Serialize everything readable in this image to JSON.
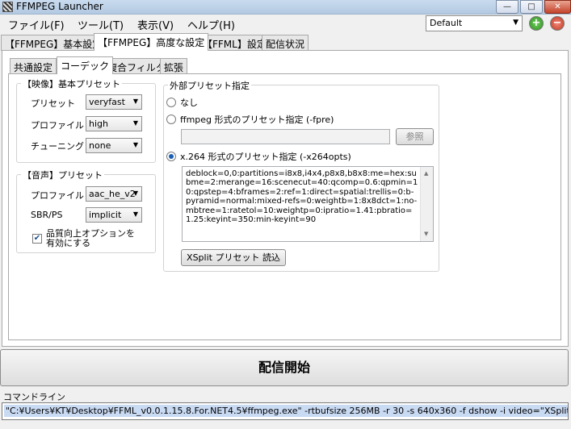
{
  "window": {
    "title": "FFMPEG Launcher"
  },
  "menu": [
    "ファイル(F)",
    "ツール(T)",
    "表示(V)",
    "ヘルプ(H)"
  ],
  "preset": {
    "selected": "Default"
  },
  "main_tabs": [
    "【FFMPEG】基本設定",
    "【FFMPEG】高度な設定",
    "【FFML】設定",
    "配信状況"
  ],
  "sub_tabs": [
    "共通設定",
    "コーデック",
    "複合フィルタ",
    "拡張"
  ],
  "video_group": {
    "title": "【映像】基本プリセット",
    "preset_label": "プリセット",
    "preset_value": "veryfast",
    "profile_label": "プロファイル",
    "profile_value": "high",
    "tuning_label": "チューニング",
    "tuning_value": "none"
  },
  "audio_group": {
    "title": "【音声】プリセット",
    "profile_label": "プロファイル",
    "profile_value": "aac_he_v2",
    "sbr_label": "SBR/PS",
    "sbr_value": "implicit",
    "quality_line1": "品質向上オプションを",
    "quality_line2": "有効にする",
    "quality_checked": true
  },
  "external_group": {
    "title": "外部プリセット指定",
    "opt_none": "なし",
    "opt_fpre": "ffmpeg 形式のプリセット指定 (-fpre)",
    "browse_label": "参照",
    "opt_x264": "x.264 形式のプリセット指定 (-x264opts)",
    "selected": "x264",
    "x264opts": "deblock=0,0:partitions=i8x8,i4x4,p8x8,b8x8:me=hex:subme=2:merange=16:scenecut=40:qcomp=0.6:qpmin=10:qpstep=4:bframes=2:ref=1:direct=spatial:trellis=0:b-pyramid=normal:mixed-refs=0:weightb=1:8x8dct=1:no-mbtree=1:ratetol=10:weightp=0:ipratio=1.41:pbratio=1.25:keyint=350:min-keyint=90",
    "xsplit_button": "XSplit プリセット 読込"
  },
  "start_button": "配信開始",
  "command": {
    "label": "コマンドライン",
    "text": "\"C:¥Users¥KT¥Desktop¥FFML_v0.0.1.15.8.For.NET4.5¥ffmpeg.exe\" -rtbufsize 256MB -r 30 -s 640x360 -f dshow -i video=\"XSplitBroadcaster\""
  }
}
